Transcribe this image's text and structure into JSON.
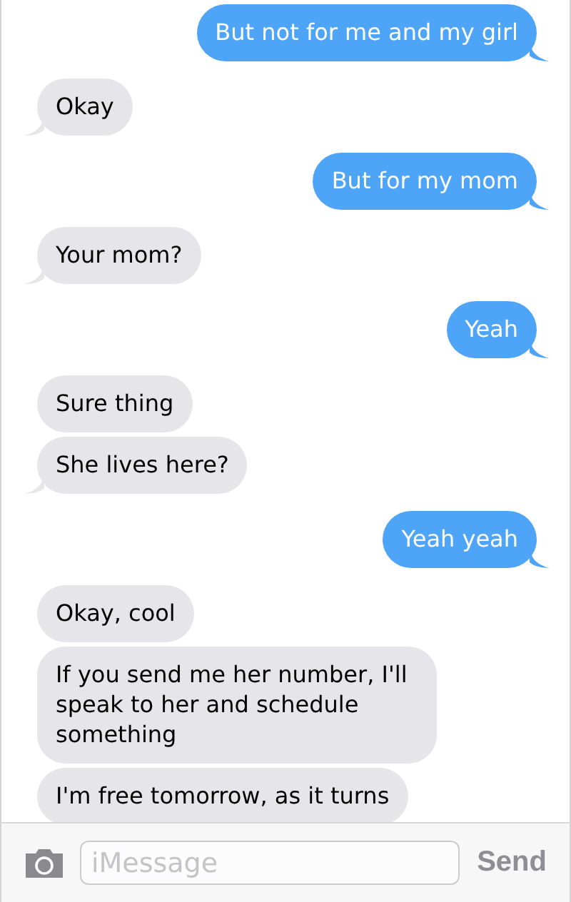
{
  "messages": [
    {
      "kind": "sent",
      "text": "But not for me and my girl",
      "tail": true
    },
    {
      "kind": "received",
      "text": "Okay",
      "tail": true
    },
    {
      "kind": "sent",
      "text": "But for my mom",
      "tail": true
    },
    {
      "kind": "received",
      "text": "Your mom?",
      "tail": true
    },
    {
      "kind": "sent",
      "text": "Yeah",
      "tail": true
    },
    {
      "kind": "received",
      "text": "Sure thing",
      "tail": false
    },
    {
      "kind": "received",
      "text": "She lives here?",
      "tail": true
    },
    {
      "kind": "sent",
      "text": "Yeah yeah",
      "tail": true
    },
    {
      "kind": "received",
      "text": "Okay, cool",
      "tail": false
    },
    {
      "kind": "received",
      "text": "If you send me her number, I'll speak to her and schedule something",
      "tail": false
    },
    {
      "kind": "received",
      "text": "I'm free tomorrow, as it turns",
      "tail": false
    }
  ],
  "composer": {
    "placeholder": "iMessage",
    "send": "Send"
  }
}
